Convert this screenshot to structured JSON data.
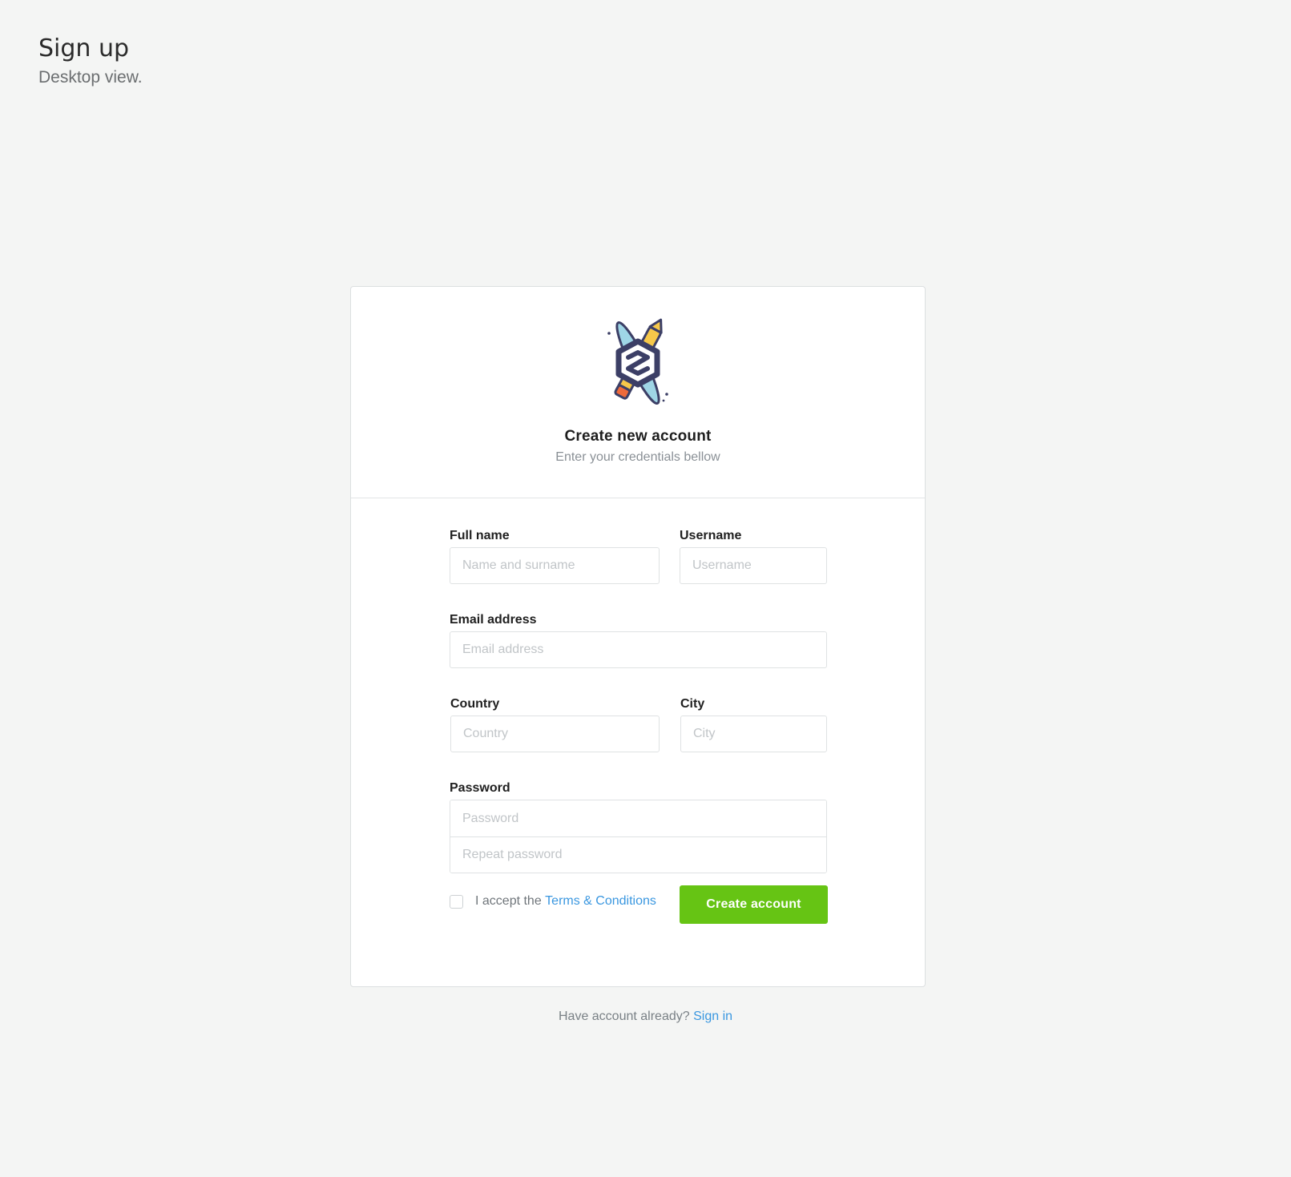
{
  "page": {
    "title": "Sign up",
    "subtitle": "Desktop view."
  },
  "card": {
    "logo_icon": "crossed-pencils-hexagon-logo",
    "title": "Create new account",
    "subtitle": "Enter your credentials bellow"
  },
  "form": {
    "full_name": {
      "label": "Full name",
      "placeholder": "Name and surname",
      "value": ""
    },
    "username": {
      "label": "Username",
      "placeholder": "Username",
      "value": ""
    },
    "email": {
      "label": "Email address",
      "placeholder": "Email address",
      "value": ""
    },
    "country": {
      "label": "Country",
      "placeholder": "Country",
      "value": ""
    },
    "city": {
      "label": "City",
      "placeholder": "City",
      "value": ""
    },
    "password": {
      "label": "Password",
      "placeholder": "Password",
      "repeat_placeholder": "Repeat password",
      "value": ""
    },
    "terms": {
      "checked": false,
      "prefix": "I accept the",
      "link_label": "Terms & Conditions"
    },
    "submit_label": "Create account"
  },
  "footer": {
    "prompt": "Have account already?",
    "link_label": "Sign in"
  },
  "colors": {
    "background": "#f4f5f4",
    "primary_button": "#66c414",
    "link": "#3a97e0"
  }
}
